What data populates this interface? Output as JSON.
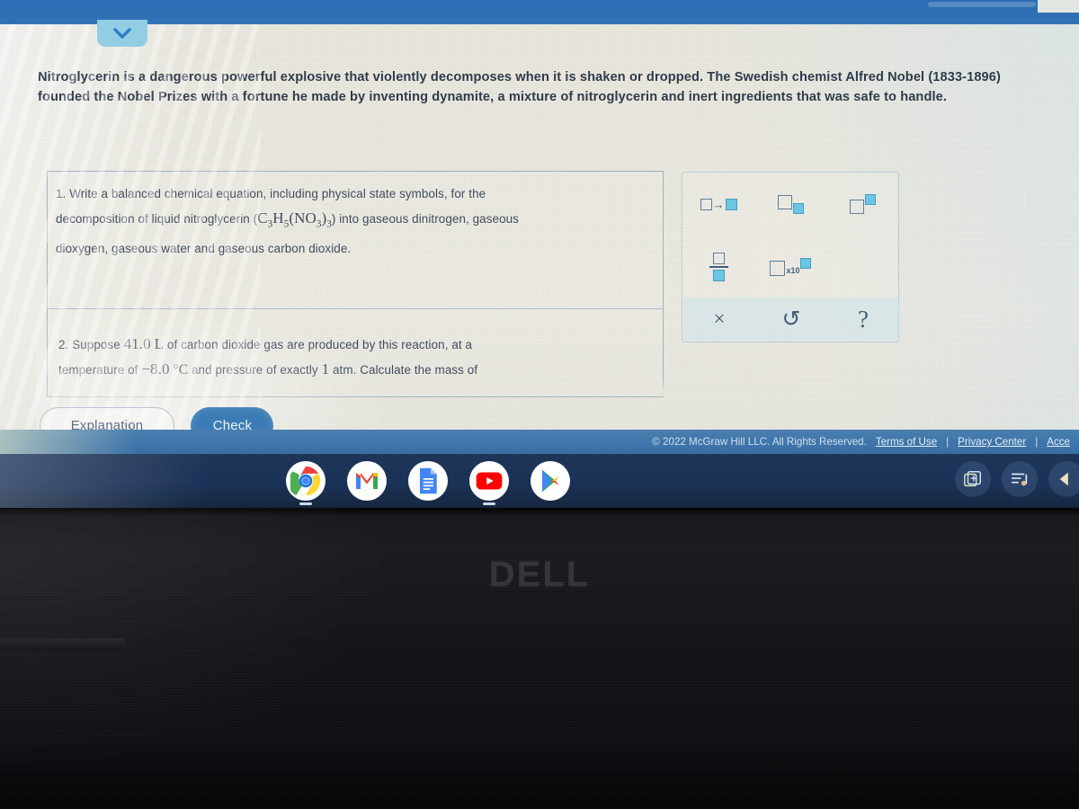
{
  "app": {
    "top_band_color": "#2f6fb2",
    "page_background": "#ece7db",
    "accent_color": "#3c7cb6",
    "collapse_tab": {
      "icon": "chevron-down-icon",
      "color": "#93cde4"
    }
  },
  "intro": {
    "text": "Nitroglycerin is a dangerous powerful explosive that violently decomposes when it is shaken or dropped. The Swedish chemist Alfred Nobel (1833-1896) founded the Nobel Prizes with a fortune he made by inventing dynamite, a mixture of nitroglycerin and inert ingredients that was safe to handle."
  },
  "questions": [
    {
      "number": "1.",
      "line1": "Write a balanced chemical equation, including physical state symbols, for the",
      "line2_pre": "decomposition of liquid nitroglycerin (",
      "formula": "C3H5(NO3)3",
      "line2_post": ") into gaseous dinitrogen, gaseous",
      "line3": "dioxygen, gaseous water and gaseous carbon dioxide.",
      "answer_value": "",
      "answer_placeholder": ""
    },
    {
      "number": "2.",
      "line1_pre": "Suppose",
      "volume": "41.0",
      "volume_unit": "L",
      "line1_post": "of carbon dioxide gas are produced by this reaction, at a",
      "line2_pre": "temperature of",
      "temperature": "−8.0",
      "temperature_unit": "°C",
      "line2_mid": "and pressure of exactly",
      "pressure": "1",
      "pressure_unit": "atm.",
      "line2_post": "Calculate the mass of"
    }
  ],
  "toolbar": {
    "name": "math-symbol-toolbar",
    "buttons": [
      {
        "name": "reaction-arrow-button",
        "label": "□→□"
      },
      {
        "name": "subscript-button",
        "label": "□□"
      },
      {
        "name": "superscript-button",
        "label": "□□"
      },
      {
        "name": "fraction-button",
        "label": "□/□"
      },
      {
        "name": "scientific-notation-button",
        "label": "□ x10□"
      }
    ],
    "actions": [
      {
        "name": "clear-button",
        "glyph": "×"
      },
      {
        "name": "undo-button",
        "glyph": "↺"
      },
      {
        "name": "help-button",
        "glyph": "?"
      }
    ]
  },
  "actions": {
    "explanation_label": "Explanation",
    "check_label": "Check"
  },
  "footer": {
    "copyright": "© 2022 McGraw Hill LLC. All Rights Reserved.",
    "links": [
      "Terms of Use",
      "Privacy Center",
      "Acce"
    ],
    "separator": "|"
  },
  "shelf": {
    "apps": [
      {
        "name": "chrome-icon",
        "label": "Chrome",
        "running": true
      },
      {
        "name": "gmail-icon",
        "label": "Gmail",
        "running": false
      },
      {
        "name": "google-docs-icon",
        "label": "Docs",
        "running": false
      },
      {
        "name": "youtube-icon",
        "label": "YouTube",
        "running": true
      },
      {
        "name": "play-store-icon",
        "label": "Play Store",
        "running": false
      }
    ],
    "tray": [
      {
        "name": "screen-capture-icon"
      },
      {
        "name": "media-playlist-icon"
      },
      {
        "name": "status-partial-icon"
      }
    ]
  },
  "hardware": {
    "brand": "DELL"
  }
}
